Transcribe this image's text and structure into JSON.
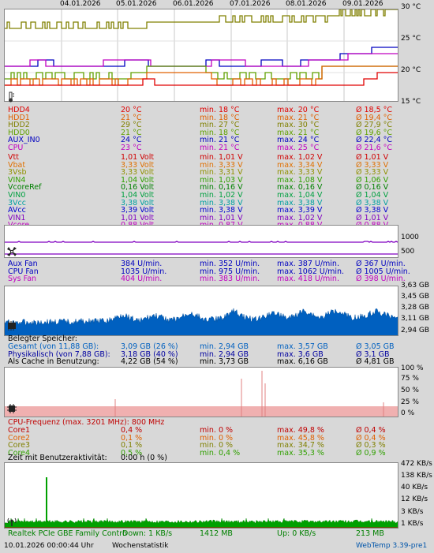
{
  "colors": {
    "accent": "#0055aa",
    "hdd4": "#e00000",
    "hdd1": "#e06000",
    "hdd2": "#808000",
    "hdd0": "#60a000",
    "aux": "#0000c0",
    "cpu": "#c000c0",
    "vtt": "#d00000",
    "vbat": "#e07000",
    "v3vsb": "#909000",
    "vin4": "#30a000",
    "vcore_ref": "#008000",
    "vin0": "#00a040",
    "v3vcc": "#00a0a0",
    "avcc": "#0000d0",
    "vin1": "#8000c0",
    "vcore": "#c000c0",
    "mem": "#0060c0",
    "cpu_freq": "#c00000",
    "core1": "#c00000",
    "core2": "#e06000",
    "core3": "#808000",
    "core4": "#30a000",
    "net": "#008000"
  },
  "temp_chart": {
    "x_labels": [
      "04.01.2026",
      "05.01.2026",
      "06.01.2026",
      "07.01.2026",
      "08.01.2026",
      "09.01.2026"
    ],
    "y_labels": [
      "30 °C",
      "25 °C",
      "20 °C",
      "15 °C"
    ],
    "icon": "thermometer-icon",
    "rows": [
      {
        "name": "HDD4",
        "cur": "20 °C",
        "min": "min. 18 °C",
        "max": "max. 20 °C",
        "avg": "Ø 18,5 °C",
        "color": "#e00000"
      },
      {
        "name": "HDD1",
        "cur": "21 °C",
        "min": "min. 18 °C",
        "max": "max. 21 °C",
        "avg": "Ø 19,4 °C",
        "color": "#e06000"
      },
      {
        "name": "HDD2",
        "cur": "29 °C",
        "min": "min. 27 °C",
        "max": "max. 30 °C",
        "avg": "Ø 27,9 °C",
        "color": "#808000"
      },
      {
        "name": "HDD0",
        "cur": "21 °C",
        "min": "min. 18 °C",
        "max": "max. 21 °C",
        "avg": "Ø 19,6 °C",
        "color": "#60a000"
      },
      {
        "name": "AUX_IN0",
        "cur": "24 °C",
        "min": "min. 21 °C",
        "max": "max. 24 °C",
        "avg": "Ø 22,4 °C",
        "color": "#0000c0"
      },
      {
        "name": "CPU",
        "cur": "23 °C",
        "min": "min. 21 °C",
        "max": "max. 25 °C",
        "avg": "Ø 21,6 °C",
        "color": "#c000c0"
      }
    ]
  },
  "volt_rows": [
    {
      "name": "Vtt",
      "cur": "1,01 Volt",
      "min": "min. 1,01 V",
      "max": "max. 1,02 V",
      "avg": "Ø 1,01 V",
      "color": "#d00000"
    },
    {
      "name": "Vbat",
      "cur": "3,33 Volt",
      "min": "min. 3,33 V",
      "max": "max. 3,34 V",
      "avg": "Ø 3,33 V",
      "color": "#e07000"
    },
    {
      "name": "3Vsb",
      "cur": "3,33 Volt",
      "min": "min. 3,31 V",
      "max": "max. 3,33 V",
      "avg": "Ø 3,33 V",
      "color": "#909000"
    },
    {
      "name": "VIN4",
      "cur": "1,04 Volt",
      "min": "min. 1,03 V",
      "max": "max. 1,08 V",
      "avg": "Ø 1,06 V",
      "color": "#30a000"
    },
    {
      "name": "VcoreRef",
      "cur": "0,16 Volt",
      "min": "min. 0,16 V",
      "max": "max. 0,16 V",
      "avg": "Ø 0,16 V",
      "color": "#008000"
    },
    {
      "name": "VIN0",
      "cur": "1,04 Volt",
      "min": "min. 1,02 V",
      "max": "max. 1,04 V",
      "avg": "Ø 1,04 V",
      "color": "#00a040"
    },
    {
      "name": "3Vcc",
      "cur": "3,38 Volt",
      "min": "min. 3,38 V",
      "max": "max. 3,38 V",
      "avg": "Ø 3,38 V",
      "color": "#00a0a0"
    },
    {
      "name": "AVcc",
      "cur": "3,39 Volt",
      "min": "min. 3,38 V",
      "max": "max. 3,39 V",
      "avg": "Ø 3,38 V",
      "color": "#0000d0"
    },
    {
      "name": "VIN1",
      "cur": "1,01 Volt",
      "min": "min. 1,01 V",
      "max": "max. 1,02 V",
      "avg": "Ø 1,01 V",
      "color": "#8000c0"
    },
    {
      "name": "Vcore",
      "cur": "0,88 Volt",
      "min": "min. 0,87 V",
      "max": "max. 0,88 V",
      "avg": "Ø 0,88 V",
      "color": "#c000c0"
    }
  ],
  "fan_chart": {
    "y_labels": [
      "1000",
      "500"
    ],
    "icon": "fan-icon",
    "rows": [
      {
        "name": "Aux Fan",
        "cur": "384 U/min.",
        "min": "min. 352 U/min.",
        "max": "max. 387 U/min.",
        "avg": "Ø 367 U/min.",
        "color": "#0000c0"
      },
      {
        "name": "CPU Fan",
        "cur": "1035 U/min.",
        "min": "min. 975 U/min.",
        "max": "max. 1062 U/min.",
        "avg": "Ø 1005 U/min.",
        "color": "#0000c0"
      },
      {
        "name": "Sys Fan",
        "cur": "404 U/min.",
        "min": "min. 383 U/min.",
        "max": "max. 418 U/min.",
        "avg": "Ø 398 U/min.",
        "color": "#c000c0"
      }
    ]
  },
  "mem_chart": {
    "y_labels": [
      "3,63 GB",
      "3,45 GB",
      "3,28 GB",
      "3,11 GB",
      "2,94 GB"
    ],
    "icon": "memory-icon",
    "header": "Belegter Speicher:",
    "rows": [
      {
        "name": "Gesamt (von 11,88 GB):",
        "cur": "3,09 GB (26 %)",
        "min": "min. 2,94 GB",
        "max": "max. 3,57 GB",
        "avg": "Ø 3,05 GB",
        "color": "#0060c0"
      },
      {
        "name": "Physikalisch (von 7,88 GB):",
        "cur": "3,18 GB (40 %)",
        "min": "min. 2,94 GB",
        "max": "max. 3,6 GB",
        "avg": "Ø 3,1 GB",
        "color": "#0000a0"
      },
      {
        "name": "Als Cache in Benutzung:",
        "cur": "4,22 GB (54 %)",
        "min": "min. 3,73 GB",
        "max": "max. 6,16 GB",
        "avg": "Ø 4,81 GB",
        "color": "#000000"
      }
    ]
  },
  "cpu_chart": {
    "y_labels": [
      "100 %",
      "75 %",
      "50 %",
      "25 %",
      "0 %"
    ],
    "icon": "cpu-icon",
    "freq": "CPU-Frequenz (max. 3201 MHz): 800 MHz",
    "rows": [
      {
        "name": "Core1",
        "cur": "0,4 %",
        "min": "min. 0 %",
        "max": "max. 49,8 %",
        "avg": "Ø 0,4 %",
        "color": "#c00000"
      },
      {
        "name": "Core2",
        "cur": "0,1 %",
        "min": "min. 0 %",
        "max": "max. 45,8 %",
        "avg": "Ø 0,4 %",
        "color": "#e06000"
      },
      {
        "name": "Core3",
        "cur": "0,1 %",
        "min": "min. 0 %",
        "max": "max. 34,7 %",
        "avg": "Ø 0,3 %",
        "color": "#808000"
      },
      {
        "name": "Core4",
        "cur": "0,5 %",
        "min": "min. 0,4 %",
        "max": "max. 35,3 %",
        "avg": "Ø 0,9 %",
        "color": "#30a000"
      }
    ],
    "activity_label": "Zeit mit Benutzeraktivität:",
    "activity_value": "0:00 h (0 %)"
  },
  "net_chart": {
    "y_labels": [
      "472 KB/s",
      "138 KB/s",
      "40 KB/s",
      "12 KB/s",
      "3 KB/s",
      "1 KB/s"
    ],
    "icon": "network-icon",
    "name": "Realtek PCIe GBE Family Contro",
    "down": "Down: 1 KB/s",
    "down_total": "1412 MB",
    "up": "Up: 0 KB/s",
    "up_total": "213 MB"
  },
  "footer": {
    "timestamp": "10.01.2026 00:00:44 Uhr",
    "mode": "Wochenstatistik",
    "app": "WebTemp 3.39-pre1"
  }
}
